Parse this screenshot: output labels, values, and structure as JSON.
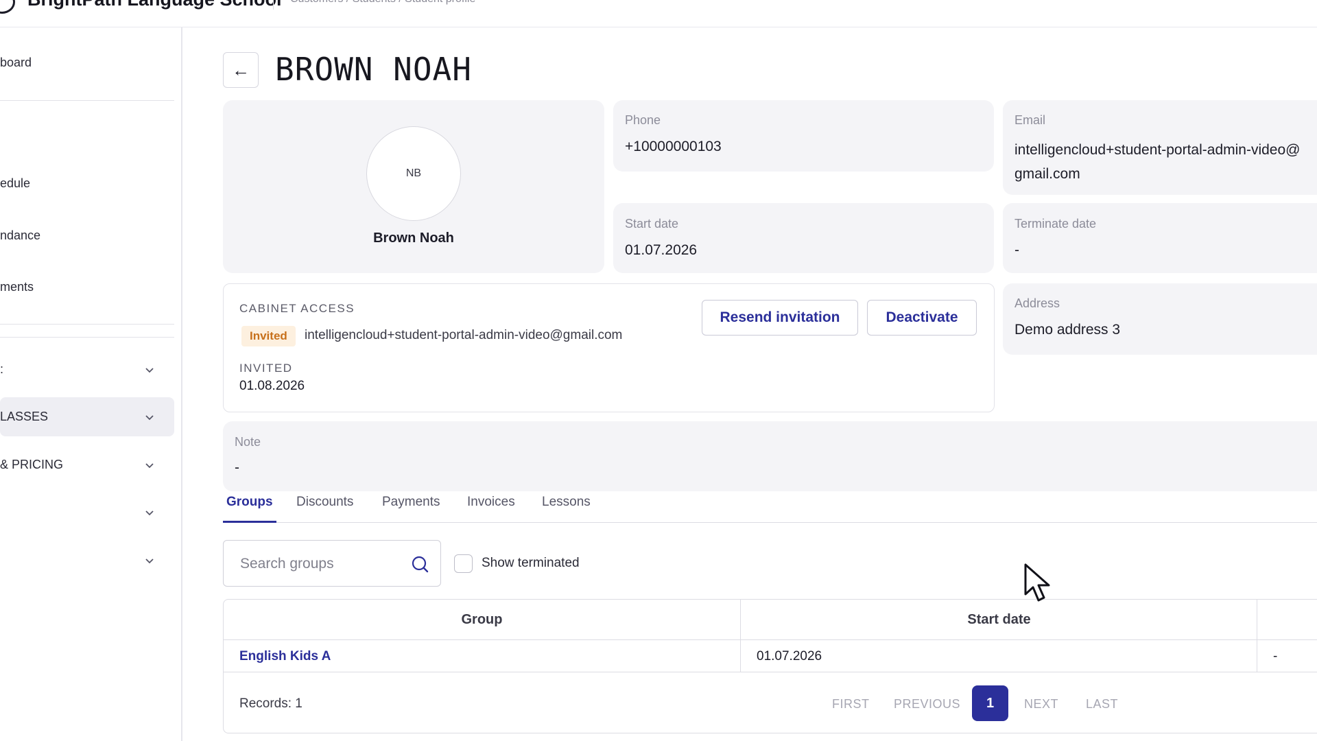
{
  "app": {
    "title": "BrightPath Language School",
    "breadcrumb": "Customers / Students / Student profile"
  },
  "sidebar": {
    "items": [
      {
        "label": "board"
      },
      {
        "label": "edule"
      },
      {
        "label": "ndance"
      },
      {
        "label": "ments"
      }
    ],
    "sections": [
      {
        "label": ":"
      },
      {
        "label": "LASSES"
      },
      {
        "label": "& PRICING"
      },
      {
        "label": ""
      },
      {
        "label": ""
      }
    ]
  },
  "header": {
    "back_icon": "←",
    "title": "BROWN NOAH"
  },
  "profile": {
    "initials": "NB",
    "name": "Brown Noah",
    "phone_label": "Phone",
    "phone": "+10000000103",
    "email_label": "Email",
    "email": "intelligencloud+student-portal-admin-video@gmail.com",
    "start_date_label": "Start date",
    "start_date": "01.07.2026",
    "terminate_date_label": "Terminate date",
    "terminate_date": "-",
    "address_label": "Address",
    "address": "Demo address 3",
    "note_label": "Note",
    "note": "-"
  },
  "cabinet": {
    "title": "CABINET ACCESS",
    "status_badge": "Invited",
    "email": "intelligencloud+student-portal-admin-video@gmail.com",
    "invited_label": "INVITED",
    "invited_date": "01.08.2026",
    "resend_label": "Resend invitation",
    "deactivate_label": "Deactivate"
  },
  "tabs": [
    {
      "label": "Groups",
      "active": true
    },
    {
      "label": "Discounts"
    },
    {
      "label": "Payments"
    },
    {
      "label": "Invoices"
    },
    {
      "label": "Lessons"
    }
  ],
  "search": {
    "placeholder": "Search groups",
    "value": ""
  },
  "filter": {
    "show_terminated_label": "Show terminated",
    "checked": false
  },
  "table": {
    "columns": [
      "Group",
      "Start date"
    ],
    "rows": [
      {
        "group": "English Kids A",
        "start_date": "01.07.2026",
        "end_date": "-"
      }
    ],
    "records_text": "Records: 1"
  },
  "pagination": {
    "first": "FIRST",
    "previous": "PREVIOUS",
    "current": "1",
    "next": "NEXT",
    "last": "LAST"
  },
  "colors": {
    "accent": "#2b2f9a",
    "badge_bg": "#fdf0df",
    "badge_text": "#c7701b",
    "card_bg": "#f4f4f7"
  },
  "icons": {
    "back": "back-arrow-icon",
    "search": "search-icon",
    "chevron": "chevron-down-icon",
    "cursor": "mouse-pointer-icon"
  }
}
